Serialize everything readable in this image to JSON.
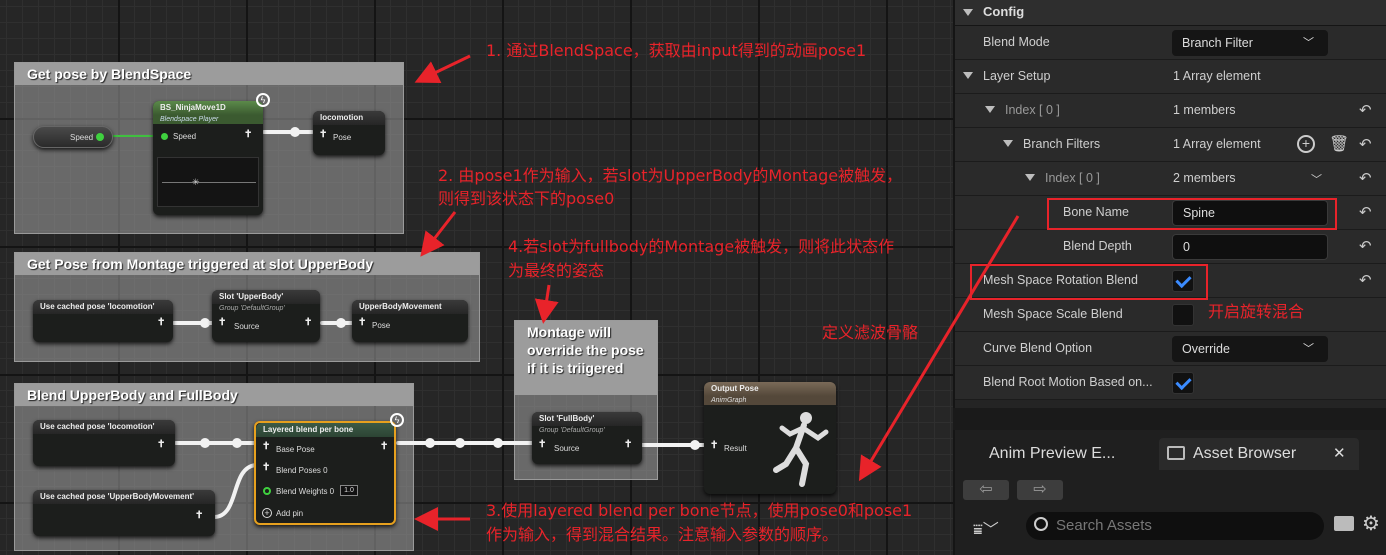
{
  "graph": {
    "comments": [
      {
        "title": "Get pose by BlendSpace"
      },
      {
        "title": "Get Pose from Montage triggered at slot UpperBody"
      },
      {
        "title": "Blend UpperBody and FullBody"
      },
      {
        "title": "Montage will override the pose if it is triigered"
      }
    ],
    "nodes": {
      "speed_var": {
        "pin": "Speed"
      },
      "blendspace": {
        "title": "BS_NinjaMove1D",
        "subtitle": "Blendspace Player",
        "pin": "Speed"
      },
      "locomotion": {
        "title": "locomotion",
        "pin": "Pose"
      },
      "cached_loco1": {
        "title": "Use cached pose 'locomotion'"
      },
      "slot_upper": {
        "title": "Slot 'UpperBody'",
        "subtitle": "Group 'DefaultGroup'",
        "pin": "Source"
      },
      "upper_move": {
        "title": "UpperBodyMovement",
        "pin": "Pose"
      },
      "cached_loco2": {
        "title": "Use cached pose 'locomotion'"
      },
      "cached_upper": {
        "title": "Use cached pose 'UpperBodyMovement'"
      },
      "layered": {
        "title": "Layered blend per bone",
        "pins": [
          "Base Pose",
          "Blend Poses 0",
          "Blend Weights 0",
          "Add pin"
        ],
        "weight_value": "1.0"
      },
      "slot_full": {
        "title": "Slot 'FullBody'",
        "subtitle": "Group 'DefaultGroup'",
        "pin": "Source"
      },
      "output": {
        "title": "Output Pose",
        "subtitle": "AnimGraph",
        "pin": "Result"
      }
    },
    "annotations": {
      "a1": "1. 通过BlendSpace，获取由input得到的动画pose1",
      "a2_l1": "2. 由pose1作为输入，若slot为UpperBody的Montage被触发，",
      "a2_l2": "则得到该状态下的pose0",
      "a4_l1": "4.若slot为fullbody的Montage被触发，则将此状态作",
      "a4_l2": "为最终的姿态",
      "a3_l1": "3.使用layered blend per bone节点，使用pose0和pose1",
      "a3_l2": "作为输入，得到混合结果。注意输入参数的顺序。",
      "filter": "定义滤波骨骼",
      "rotation": "开启旋转混合"
    }
  },
  "details": {
    "section": "Config",
    "rows": [
      {
        "label": "Blend Mode",
        "value": "Branch Filter"
      },
      {
        "label": "Layer Setup",
        "value": "1 Array element"
      },
      {
        "label": "Index [ 0 ]",
        "value": "1 members"
      },
      {
        "label": "Branch Filters",
        "value": "1 Array element"
      },
      {
        "label": "Index [ 0 ]",
        "value": "2 members"
      },
      {
        "label": "Bone Name",
        "value": "Spine"
      },
      {
        "label": "Blend Depth",
        "value": "0"
      },
      {
        "label": "Mesh Space Rotation Blend",
        "value": "true"
      },
      {
        "label": "Mesh Space Scale Blend",
        "value": "false"
      },
      {
        "label": "Curve Blend Option",
        "value": "Override"
      },
      {
        "label": "Blend Root Motion Based on...",
        "value": "true"
      }
    ]
  },
  "bottom": {
    "tabs": [
      "Anim Preview E...",
      "Asset Browser"
    ],
    "search_placeholder": "Search Assets"
  },
  "colors": {
    "accent": "#e8232a",
    "check": "#3b8bff",
    "wire": "#f2f2f2"
  }
}
